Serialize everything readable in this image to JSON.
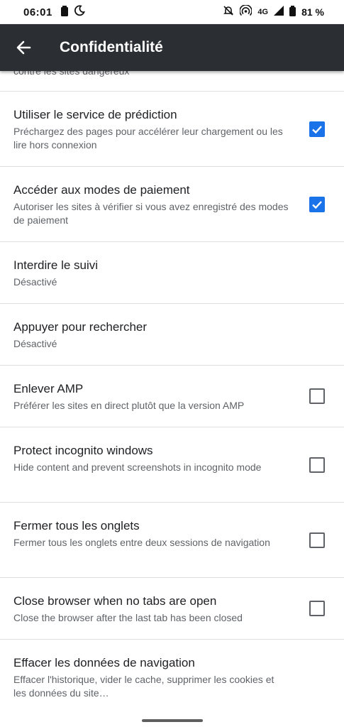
{
  "status_bar": {
    "time": "06:01",
    "network": "4G",
    "battery": "81 %",
    "icons": [
      "battery-icon",
      "moon-icon",
      "bell-off-icon",
      "hotspot-icon",
      "signal-icon",
      "battery-icon"
    ]
  },
  "app_bar": {
    "title": "Confidentialité"
  },
  "partial_item": {
    "summary": "contre les sites dangereux"
  },
  "settings": [
    {
      "title": "Utiliser le service de prédiction",
      "summary": "Préchargez des pages pour accélérer leur chargement ou les lire hors connexion",
      "checked": true
    },
    {
      "title": "Accéder aux modes de paiement",
      "summary": "Autoriser les sites à vérifier si vous avez enregistré des modes de paiement",
      "checked": true
    },
    {
      "title": "Interdire le suivi",
      "summary": "Désactivé"
    },
    {
      "title": "Appuyer pour rechercher",
      "summary": "Désactivé"
    },
    {
      "title": "Enlever AMP",
      "summary": "Préférer les sites en direct plutôt que la version AMP",
      "checked": false
    },
    {
      "title": "Protect incognito windows",
      "summary": "Hide content and prevent screenshots in incognito mode",
      "checked": false
    },
    {
      "title": "Fermer tous les onglets",
      "summary": "Fermer tous les onglets entre deux sessions de navigation",
      "checked": false
    },
    {
      "title": "Close browser when no tabs are open",
      "summary": "Close the browser after the last tab has been closed",
      "checked": false
    },
    {
      "title": "Effacer les données de navigation",
      "summary": "Effacer l'historique, vider le cache, supprimer les cookies et les données du site…"
    }
  ],
  "colors": {
    "app_bar": "#2b2f33",
    "accent": "#1a73e8",
    "divider": "#e0e0e0"
  }
}
